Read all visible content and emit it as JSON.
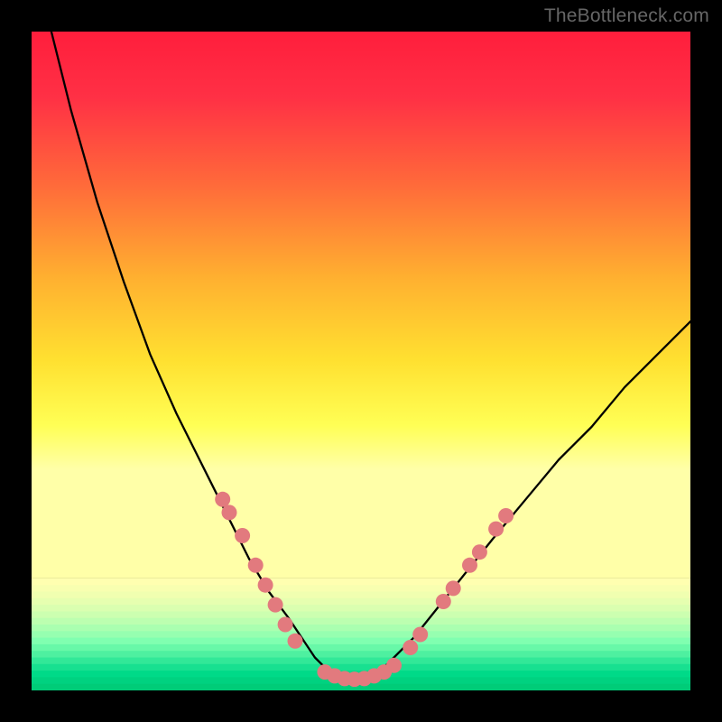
{
  "watermark": "TheBottleneck.com",
  "chart_data": {
    "type": "line",
    "title": "",
    "xlabel": "",
    "ylabel": "",
    "xlim": [
      0,
      100
    ],
    "ylim": [
      0,
      100
    ],
    "curve": {
      "name": "bottleneck-curve",
      "x": [
        3,
        6,
        10,
        14,
        18,
        22,
        26,
        30,
        33,
        36,
        39,
        41,
        43,
        45,
        47,
        49,
        51,
        53,
        55,
        58,
        62,
        66,
        70,
        75,
        80,
        85,
        90,
        95,
        100
      ],
      "y": [
        100,
        88,
        74,
        62,
        51,
        42,
        34,
        26,
        20,
        15,
        11,
        8,
        5,
        3,
        2,
        1,
        2,
        3,
        5,
        8,
        13,
        18,
        23,
        29,
        35,
        40,
        46,
        51,
        56
      ]
    },
    "points": {
      "name": "data-points",
      "color": "#e27a7e",
      "coords": [
        [
          29,
          29
        ],
        [
          30,
          27
        ],
        [
          32,
          23.5
        ],
        [
          34,
          19
        ],
        [
          35.5,
          16
        ],
        [
          37,
          13
        ],
        [
          38.5,
          10
        ],
        [
          40,
          7.5
        ],
        [
          44.5,
          2.8
        ],
        [
          46,
          2.2
        ],
        [
          47.5,
          1.8
        ],
        [
          49,
          1.7
        ],
        [
          50.5,
          1.8
        ],
        [
          52,
          2.2
        ],
        [
          53.5,
          2.8
        ],
        [
          55,
          3.8
        ],
        [
          57.5,
          6.5
        ],
        [
          59,
          8.5
        ],
        [
          62.5,
          13.5
        ],
        [
          64,
          15.5
        ],
        [
          66.5,
          19
        ],
        [
          68,
          21
        ],
        [
          70.5,
          24.5
        ],
        [
          72,
          26.5
        ]
      ]
    },
    "gradient_bands": [
      {
        "y": 0,
        "color": "#ff1a3a"
      },
      {
        "y": 45,
        "color": "#ffd400"
      },
      {
        "y": 68,
        "color": "#ffff66"
      }
    ],
    "bottom_stripes": [
      "#ffffb0",
      "#f8ffb0",
      "#f0ffb0",
      "#e6ffb0",
      "#daffb0",
      "#ccffb0",
      "#bcffb0",
      "#aaffb0",
      "#96ffb0",
      "#80ffb0",
      "#68f8a8",
      "#4ef0a0",
      "#32e898",
      "#18e090",
      "#00da88",
      "#00d280",
      "#00cc78"
    ]
  }
}
